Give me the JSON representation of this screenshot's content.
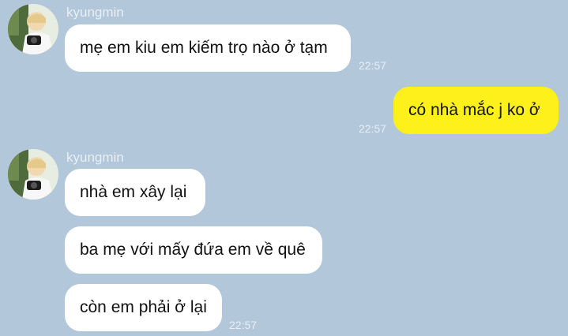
{
  "colors": {
    "background": "#b2c7d9",
    "incoming_bubble": "#ffffff",
    "outgoing_bubble": "#fef01b",
    "meta_text": "#e9eff5"
  },
  "messages": [
    {
      "sender": "kyungmin",
      "text": "mẹ em kiu em kiếm trọ nào ở tạm",
      "time": "22:57"
    },
    {
      "text": "có nhà mắc j ko ở",
      "time": "22:57"
    },
    {
      "sender": "kyungmin",
      "text": "nhà em xây lại"
    },
    {
      "text": "ba mẹ với mấy đứa em về quê"
    },
    {
      "text": "còn em phải ở lại",
      "time": "22:57"
    }
  ]
}
